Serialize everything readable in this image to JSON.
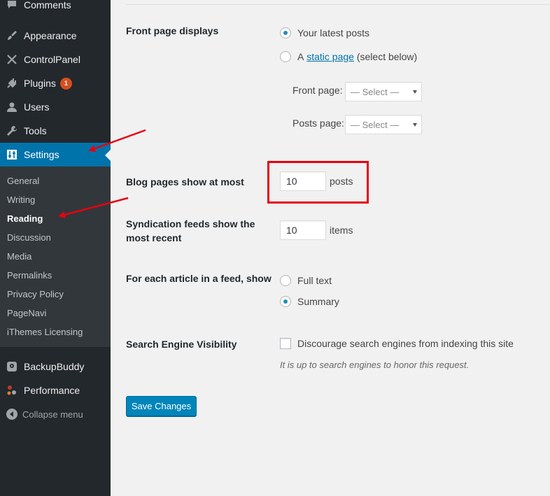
{
  "sidebar": {
    "items": [
      {
        "label": "Comments",
        "icon": "comment-icon"
      },
      {
        "label": "Appearance",
        "icon": "paintbrush-icon"
      },
      {
        "label": "ControlPanel",
        "icon": "crossed-tools-icon"
      },
      {
        "label": "Plugins",
        "icon": "plugin-icon",
        "badge": "1"
      },
      {
        "label": "Users",
        "icon": "user-icon"
      },
      {
        "label": "Tools",
        "icon": "wrench-icon"
      },
      {
        "label": "Settings",
        "icon": "sliders-icon"
      }
    ],
    "submenu": [
      "General",
      "Writing",
      "Reading",
      "Discussion",
      "Media",
      "Permalinks",
      "Privacy Policy",
      "PageNavi",
      "iThemes Licensing"
    ],
    "extra_items": [
      {
        "label": "BackupBuddy",
        "icon": "backup-icon"
      },
      {
        "label": "Performance",
        "icon": "performance-icon"
      }
    ],
    "collapse_label": "Collapse menu"
  },
  "form": {
    "front_page_displays": {
      "label": "Front page displays",
      "option_latest": "Your latest posts",
      "option_static_prefix": "A",
      "option_static_link": "static page",
      "option_static_suffix": "(select below)",
      "front_page_label": "Front page:",
      "posts_page_label": "Posts page:",
      "select_placeholder": "— Select —"
    },
    "blog_pages": {
      "label": "Blog pages show at most",
      "value": "10",
      "unit": "posts"
    },
    "syndication": {
      "label_line1": "Syndication feeds show the",
      "label_line2": "most recent",
      "value": "10",
      "unit": "items"
    },
    "feed_article": {
      "label": "For each article in a feed, show",
      "option_full": "Full text",
      "option_summary": "Summary"
    },
    "search_visibility": {
      "label": "Search Engine Visibility",
      "checkbox_label": "Discourage search engines from indexing this site",
      "description": "It is up to search engines to honor this request."
    },
    "save_label": "Save Changes"
  },
  "colors": {
    "accent": "#0073aa",
    "annotation": "#e8000f",
    "sidebar_bg": "#23282d"
  }
}
